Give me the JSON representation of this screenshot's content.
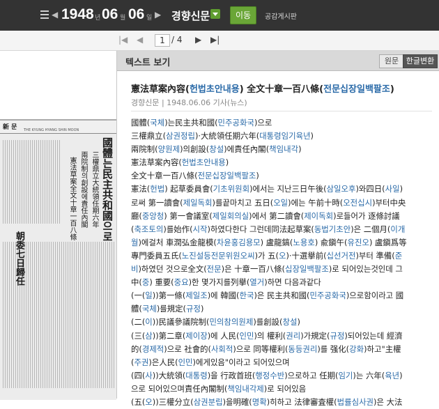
{
  "toolbar": {
    "year": "1948",
    "year_unit": "년",
    "month": "06",
    "month_unit": "월",
    "day": "06",
    "day_unit": "일",
    "newspaper": "경향신문",
    "go_label": "이동",
    "board_label": "공감게시판"
  },
  "pager": {
    "current_page": "1",
    "total": "/ 4"
  },
  "scan": {
    "masthead": "新 문",
    "masthead_sub": "THE KYUNG HYANG SHIN MOON",
    "headline1": "國體는民主共和國으로",
    "headline2": "三權鼎立大統領任期六年",
    "headline3": "兩院制의創設에責任內閣",
    "headline4": "憲法草案全文十章一百八條",
    "headline5": "朝委七日歸任"
  },
  "panel": {
    "title": "텍스트 보기",
    "tab_original": "원문",
    "tab_converted": "한글변환",
    "article_title_a": "憲法草案內容(",
    "article_title_b": "헌법초안내용",
    "article_title_c": ") 全文十章一百八條(",
    "article_title_d": "전문십장일백팔조",
    "article_title_e": ")",
    "meta": "경향신문 | 1948.06.06 기사(뉴스)"
  },
  "body": [
    {
      "segs": [
        [
          "國體(",
          0
        ],
        [
          "국체",
          1
        ],
        [
          ")는民主共和國(",
          0
        ],
        [
          "민주공화국",
          1
        ],
        [
          ")으로",
          0
        ]
      ]
    },
    {
      "segs": [
        [
          "三權鼎立(",
          0
        ],
        [
          "삼권정립",
          1
        ],
        [
          ")·大統領任期六年(",
          0
        ],
        [
          "대통령임기육년",
          1
        ],
        [
          ")",
          0
        ]
      ]
    },
    {
      "segs": [
        [
          "兩院制(",
          0
        ],
        [
          "양원제",
          1
        ],
        [
          ")의創設(",
          0
        ],
        [
          "창설",
          1
        ],
        [
          ")에責任內閣(",
          0
        ],
        [
          "책임내각",
          1
        ],
        [
          ")",
          0
        ]
      ]
    },
    {
      "segs": [
        [
          "憲法草案內容(",
          0
        ],
        [
          "헌법초안내용",
          1
        ],
        [
          ")",
          0
        ]
      ]
    },
    {
      "segs": [
        [
          "全文十章一百八條(",
          0
        ],
        [
          "전문십장일백팔조",
          1
        ],
        [
          ")",
          0
        ]
      ]
    },
    {
      "segs": [
        [
          "憲法(",
          0
        ],
        [
          "헌법",
          1
        ],
        [
          ") 起草委員會(",
          0
        ],
        [
          "기초위원회",
          1
        ],
        [
          ")에서는 지난三日午後(",
          0
        ],
        [
          "삼일오후",
          1
        ],
        [
          ")와四日(",
          0
        ],
        [
          "사일",
          1
        ],
        [
          ")",
          0
        ]
      ]
    },
    {
      "segs": [
        [
          "로써 第一讀會(",
          0
        ],
        [
          "제일독회",
          1
        ],
        [
          ")를끝마치고 五日(",
          0
        ],
        [
          "오일",
          1
        ],
        [
          ")에는 午前十時(",
          0
        ],
        [
          "오전십시",
          1
        ],
        [
          ")부터中央",
          0
        ]
      ]
    },
    {
      "segs": [
        [
          "廳(",
          0
        ],
        [
          "중앙청",
          1
        ],
        [
          ") 第一會議室(",
          0
        ],
        [
          "제일회의실",
          1
        ],
        [
          ")에서 第二讀會(",
          0
        ],
        [
          "제이독회",
          1
        ],
        [
          ")로들어가 逐條討議",
          0
        ]
      ]
    },
    {
      "segs": [
        [
          "(",
          0
        ],
        [
          "축조토의",
          1
        ],
        [
          ")를始作(",
          0
        ],
        [
          "시작",
          1
        ],
        [
          ")하였다한다 그런데同法起草案(",
          0
        ],
        [
          "동법기초안",
          1
        ],
        [
          ")은 二個月(",
          0
        ],
        [
          "이개",
          1
        ]
      ]
    },
    {
      "segs": [
        [
          "월",
          1
        ],
        [
          ")에걸처 車潤弘金龍模(",
          0
        ],
        [
          "차윤홍김용모",
          1
        ],
        [
          ") 盧龍鎬(",
          0
        ],
        [
          "노용호",
          1
        ],
        [
          ") 兪鎭午(",
          0
        ],
        [
          "유진오",
          1
        ],
        [
          ") 盧鎭爲等",
          0
        ]
      ]
    },
    {
      "segs": [
        [
          "專門委員五氏(",
          0
        ],
        [
          "노진설등전문위원오씨",
          1
        ],
        [
          ")가 五(",
          0
        ],
        [
          "오",
          1
        ],
        [
          ")·十選擧前(",
          0
        ],
        [
          "십선거전",
          1
        ],
        [
          ")부터 準備(",
          0
        ],
        [
          "준",
          1
        ]
      ]
    },
    {
      "segs": [
        [
          "비",
          1
        ],
        [
          ")하였던 것으로全文(",
          0
        ],
        [
          "전문",
          1
        ],
        [
          ")은 十章一百八條(",
          0
        ],
        [
          "십장일백팔조",
          1
        ],
        [
          ")로 되어있는것인데 그",
          0
        ]
      ]
    },
    {
      "segs": [
        [
          "中(",
          0
        ],
        [
          "중",
          1
        ],
        [
          ") 重要(",
          0
        ],
        [
          "중요",
          1
        ],
        [
          ")한 몇가지를列擧(",
          0
        ],
        [
          "열거",
          1
        ],
        [
          ")하면 다음과같다",
          0
        ]
      ]
    },
    {
      "segs": [
        [
          "(一(",
          0
        ],
        [
          "일",
          1
        ],
        [
          "))第一條(",
          0
        ],
        [
          "제일조",
          1
        ],
        [
          ")에 韓國(",
          0
        ],
        [
          "한국",
          1
        ],
        [
          ")은 民主共和國(",
          0
        ],
        [
          "민주공화국",
          1
        ],
        [
          ")으로함이라고 國",
          0
        ]
      ]
    },
    {
      "segs": [
        [
          "體(",
          0
        ],
        [
          "국체",
          1
        ],
        [
          ")를規定(",
          0
        ],
        [
          "규정",
          1
        ],
        [
          ")",
          0
        ]
      ]
    },
    {
      "segs": [
        [
          "(二(",
          0
        ],
        [
          "이",
          1
        ],
        [
          "))民議參議院制(",
          0
        ],
        [
          "민의참의원제",
          1
        ],
        [
          ")를創設(",
          0
        ],
        [
          "창설",
          1
        ],
        [
          ")",
          0
        ]
      ]
    },
    {
      "segs": [
        [
          "(三(",
          0
        ],
        [
          "삼",
          1
        ],
        [
          "))第二章(",
          0
        ],
        [
          "제이장",
          1
        ],
        [
          ")에 人民(",
          0
        ],
        [
          "인민",
          1
        ],
        [
          ")의 權利(",
          0
        ],
        [
          "권리",
          1
        ],
        [
          ")가規定(",
          0
        ],
        [
          "규정",
          1
        ],
        [
          ")되어있는데 經濟",
          0
        ]
      ]
    },
    {
      "segs": [
        [
          "的(",
          0
        ],
        [
          "경제적",
          1
        ],
        [
          ")으로 社會的(",
          0
        ],
        [
          "사회적",
          1
        ],
        [
          ")으로 同等權利(",
          0
        ],
        [
          "동등권리",
          1
        ],
        [
          ")를 强化(",
          0
        ],
        [
          "강화",
          1
        ],
        [
          ")하고\"主權",
          0
        ]
      ]
    },
    {
      "segs": [
        [
          "(",
          0
        ],
        [
          "주권",
          1
        ],
        [
          ")은人民(",
          0
        ],
        [
          "인민",
          1
        ],
        [
          ")에게있음\"이라고 되어있으며",
          0
        ]
      ]
    },
    {
      "segs": [
        [
          "(四(",
          0
        ],
        [
          "사",
          1
        ],
        [
          "))大統領(",
          0
        ],
        [
          "대통령",
          1
        ],
        [
          ")을 行政首班(",
          0
        ],
        [
          "행정수반",
          1
        ],
        [
          ")으로하고 任期(",
          0
        ],
        [
          "임기",
          1
        ],
        [
          ")는 六年(",
          0
        ],
        [
          "육년",
          1
        ],
        [
          ")",
          0
        ]
      ]
    },
    {
      "segs": [
        [
          "으로 되어있으며責任內閣制(",
          0
        ],
        [
          "책임내각제",
          1
        ],
        [
          ")로 되어있음",
          0
        ]
      ]
    },
    {
      "segs": [
        [
          "(五(",
          0
        ],
        [
          "오",
          1
        ],
        [
          "))三權分立(",
          0
        ],
        [
          "삼권분립",
          1
        ],
        [
          ")을明確(",
          0
        ],
        [
          "명확",
          1
        ],
        [
          ")히하고 法律審査權(",
          0
        ],
        [
          "법률심사권",
          1
        ],
        [
          ")은 大法",
          0
        ]
      ]
    }
  ],
  "colors": {
    "topbar": "#333333",
    "accent_green": "#6aa637",
    "highlight_blue": "#2a6aa8"
  }
}
